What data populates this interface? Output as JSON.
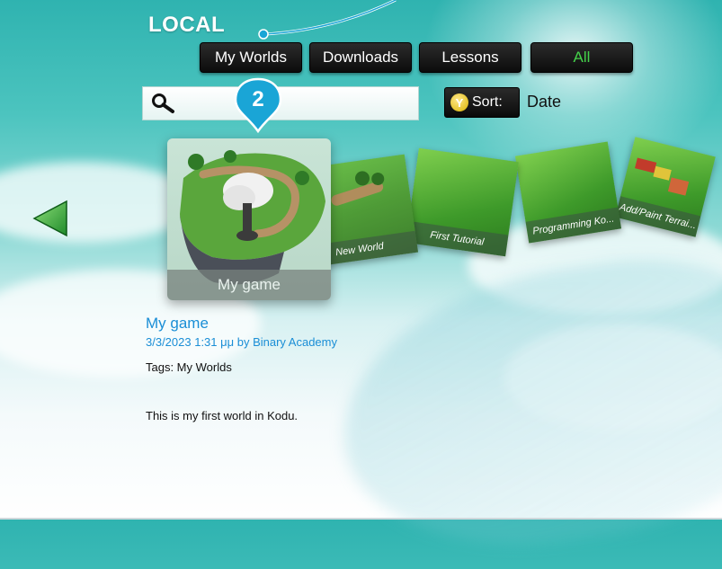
{
  "header": {
    "section_title": "LOCAL"
  },
  "tabs": [
    {
      "label": "My Worlds",
      "active": false
    },
    {
      "label": "Downloads",
      "active": false
    },
    {
      "label": "Lessons",
      "active": false
    },
    {
      "label": "All",
      "active": true
    }
  ],
  "search": {
    "value": "",
    "placeholder": ""
  },
  "callout": {
    "number": "2"
  },
  "sort": {
    "button_badge": "Y",
    "button_label": "Sort:",
    "value": "Date"
  },
  "carousel": {
    "items": [
      {
        "label": "My game",
        "selected": true
      },
      {
        "label": "New World"
      },
      {
        "label": "First Tutorial"
      },
      {
        "label": "Programming Ko..."
      },
      {
        "label": "Add/Paint Terrai..."
      }
    ]
  },
  "details": {
    "title": "My game",
    "meta": "3/3/2023 1:31 μμ by Binary Academy",
    "tags": "Tags: My Worlds",
    "description": "This is my first world in Kodu."
  },
  "colors": {
    "accent_green": "#44d24a",
    "link_blue": "#1a8ed6",
    "callout_blue": "#1aa5d6",
    "button_black": "#0c0c0c"
  },
  "icons": [
    "search-icon",
    "back-arrow-icon",
    "y-button-icon",
    "callout-pin-icon"
  ]
}
